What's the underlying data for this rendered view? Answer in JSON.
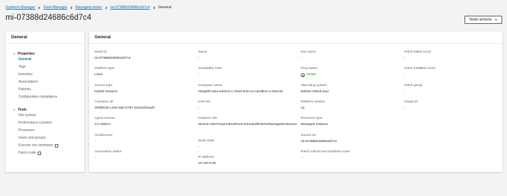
{
  "breadcrumb": {
    "items": [
      "Systems Manager",
      "Fleet Manager",
      "Managed nodes",
      "mi-07388d24686c6d7c4"
    ],
    "current": "General"
  },
  "page_title": "mi-07388d24686c6d7c4",
  "node_actions_label": "Node actions",
  "sidebar": {
    "title": "General",
    "properties": {
      "label": "Properties",
      "items": [
        "General",
        "Tags",
        "Inventory",
        "Associations",
        "Patches",
        "Configuration compliance"
      ]
    },
    "tools": {
      "label": "Tools",
      "items": [
        "File system",
        "Performance counters",
        "Processes",
        "Users and groups",
        "Execute run command",
        "Patch node"
      ]
    }
  },
  "main": {
    "title": "General",
    "columns": [
      [
        {
          "label": "Node ID",
          "value": "mi-07388d24686c6d7c4"
        },
        {
          "label": "Platform type",
          "value": "Linux"
        },
        {
          "label": "Source type",
          "value": "Hybrid instance"
        },
        {
          "label": "Activation ID",
          "value": "302fbb2b-c429-4afc-b7d7-2a3131feaaf3"
        },
        {
          "label": "Agent version",
          "value": "3.2.2303.0"
        },
        {
          "label": "Architecture",
          "value": "-"
        },
        {
          "label": "Association status",
          "value": "-"
        }
      ],
      [
        {
          "label": "Name",
          "value": "-"
        },
        {
          "label": "Availability zone",
          "value": "-"
        },
        {
          "label": "Computer name",
          "value": "ming000.asia-east1-b.c.cloud-tech-ce-sandbox-1.internal"
        },
        {
          "label": "IAM role",
          "value": "-"
        },
        {
          "label": "Instance role",
          "value": "service-role/AmazonEC2RunCommandRoleForManagedInstances"
        },
        {
          "label": "Node state",
          "value": "-"
        },
        {
          "label": "IP address",
          "value": "10.140.0.28"
        }
      ],
      [
        {
          "label": "Key name",
          "value": "-"
        },
        {
          "label": "Ping status",
          "value": "Online"
        },
        {
          "label": "Operating system",
          "value": "Debian GNU/Linux"
        },
        {
          "label": "Platform version",
          "value": "12"
        },
        {
          "label": "Resource type",
          "value": "Managed instance"
        },
        {
          "label": "Source ID",
          "value": "mi-07388d24686c6d7c4"
        },
        {
          "label": "Patch critical noncompliant count",
          "value": "-"
        }
      ],
      [
        {
          "label": "Patch failed count",
          "value": "-"
        },
        {
          "label": "Patch installed count",
          "value": "-"
        },
        {
          "label": "Patch group",
          "value": "-"
        },
        {
          "label": "Image ID",
          "value": "-"
        }
      ]
    ]
  },
  "colors": {
    "link": "#0073bb",
    "success": "#1d8102",
    "background": "#f2f3f3"
  }
}
